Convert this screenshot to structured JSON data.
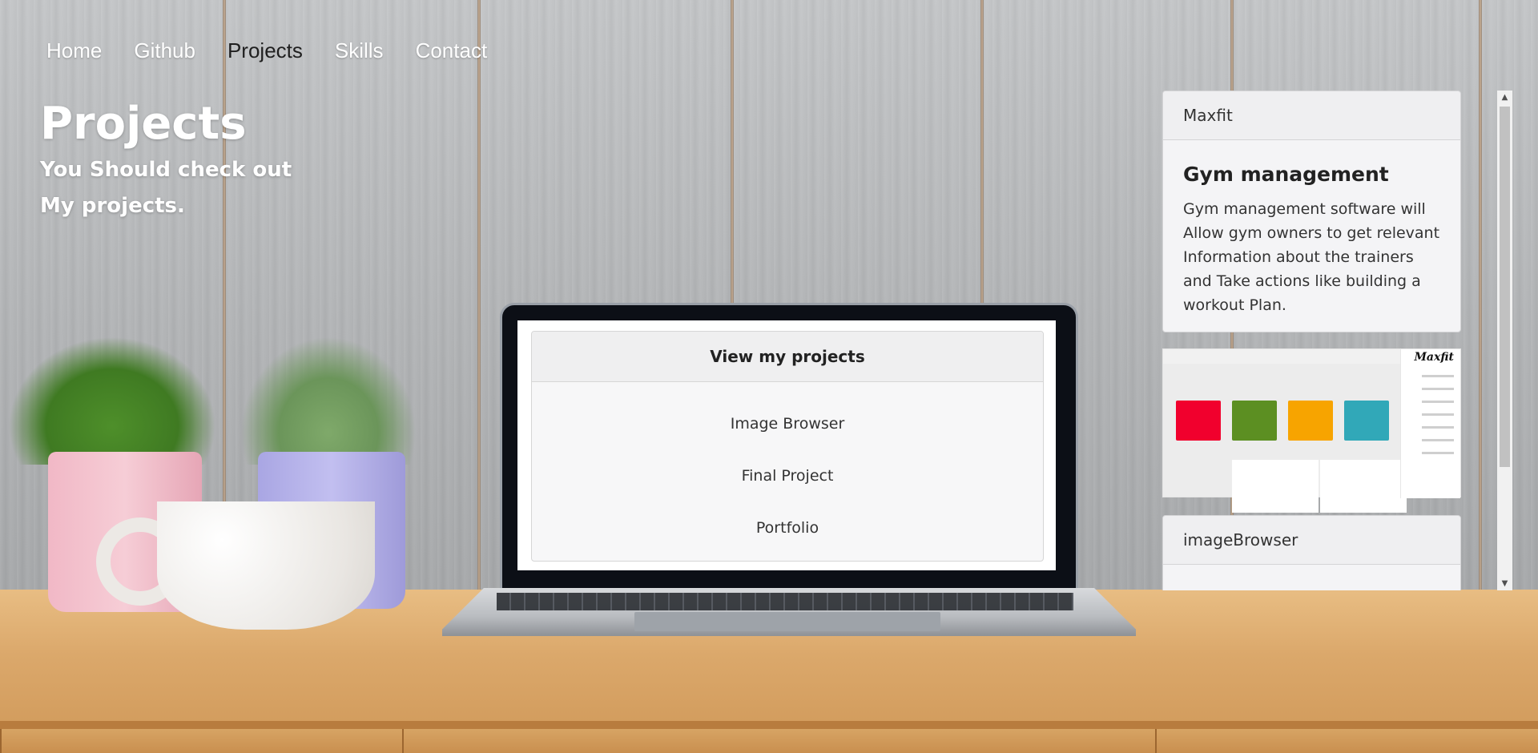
{
  "nav": {
    "items": [
      {
        "label": "Home"
      },
      {
        "label": "Github"
      },
      {
        "label": "Projects"
      },
      {
        "label": "Skills"
      },
      {
        "label": "Contact"
      }
    ],
    "active": "Projects"
  },
  "hero": {
    "title": "Projects",
    "subtitle_line1": "You Should check out",
    "subtitle_line2": "My projects."
  },
  "projects_card": {
    "header": "View my projects",
    "items": [
      {
        "label": "Image Browser"
      },
      {
        "label": "Final Project"
      },
      {
        "label": "Portfolio"
      }
    ]
  },
  "side_panel": {
    "cards": [
      {
        "header": "Maxfit",
        "title": "Gym management",
        "text": "Gym management software will Allow gym owners to get relevant Information about the trainers and Take actions like building a workout Plan.",
        "screenshot_logo": "Maxfit"
      },
      {
        "header": "imageBrowser"
      }
    ]
  },
  "colors": {
    "tile_red": "#f1002d",
    "tile_green": "#5c8f22",
    "tile_orange": "#f7a400",
    "tile_teal": "#31a8b8"
  },
  "scrollbar": {
    "up_arrow": "▲",
    "down_arrow": "▼"
  }
}
